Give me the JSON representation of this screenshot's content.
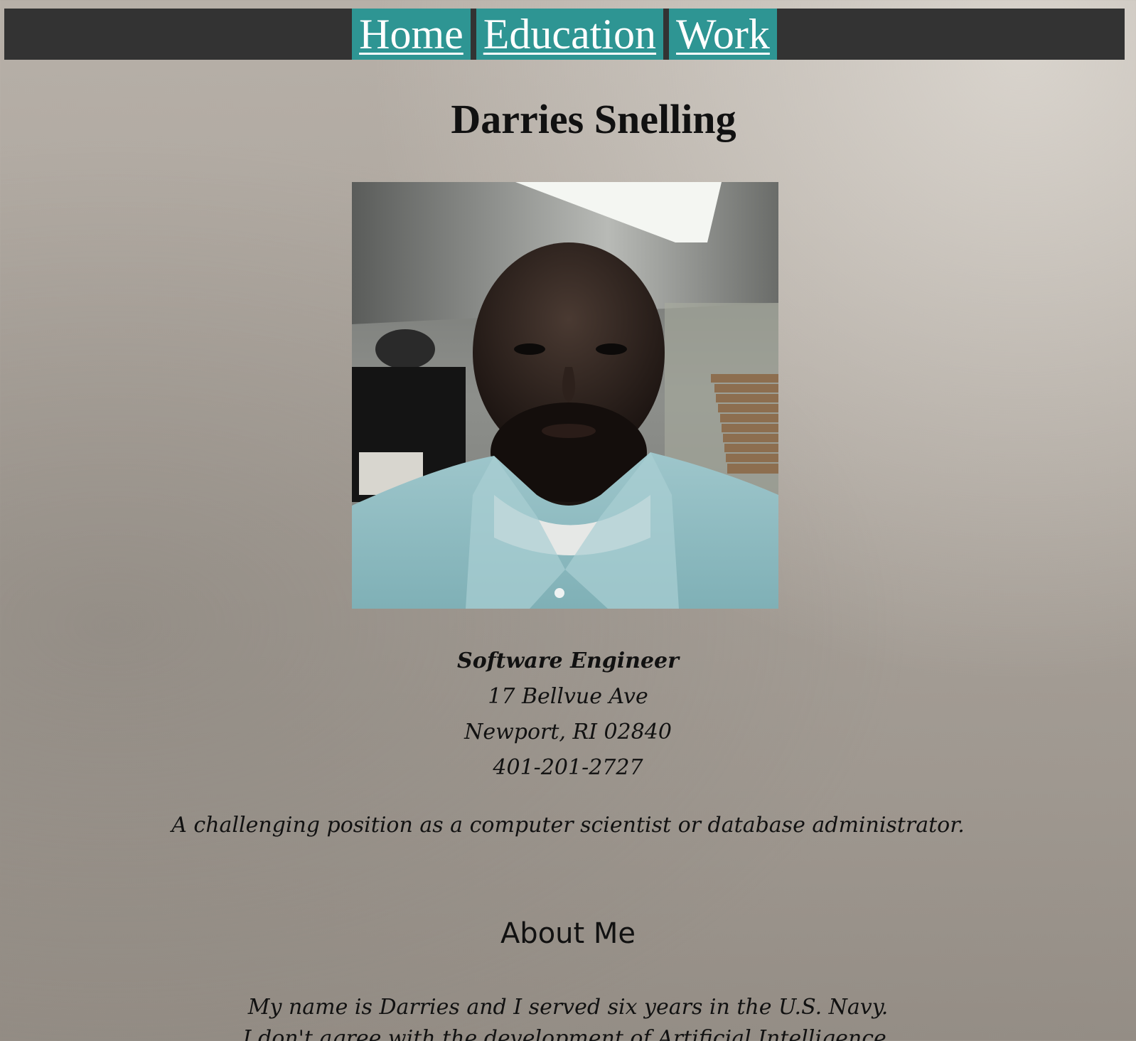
{
  "nav": {
    "items": [
      {
        "label": "Home"
      },
      {
        "label": "Education"
      },
      {
        "label": "Work"
      }
    ]
  },
  "profile": {
    "name": "Darries Snelling",
    "title": "Software Engineer",
    "address_line1": "17 Bellvue Ave",
    "address_line2": "Newport, RI 02840",
    "phone": "401-201-2727",
    "objective": "A challenging position as a computer scientist or database administrator."
  },
  "about": {
    "heading": "About Me",
    "paragraph_lines": [
      "My name is Darries and I served six years in the U.S. Navy.",
      "I don't agree with the development of Artificial Intelligence."
    ]
  },
  "colors": {
    "nav_bar": "#333333",
    "nav_link_bg": "#2e9593",
    "nav_link_text": "#ffffff"
  }
}
